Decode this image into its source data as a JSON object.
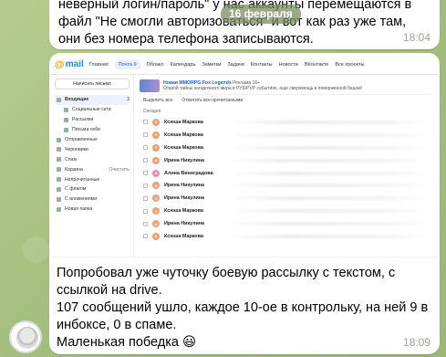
{
  "top_message": {
    "text": "неверный логин/пароль\" у нас аккаунты перемещаются в файл \"Не смогли авторизоваться\" и вот как раз уже там, они без номера телефона записываются.",
    "time": "18:04"
  },
  "date_separator": "16 февраля",
  "screenshot": {
    "logo": "mail",
    "nav": [
      "Главная",
      "Почта 9",
      "Облако",
      "Календарь",
      "Заметки",
      "Задачи",
      "Контакты",
      "Новости",
      "ВКонтакте",
      "Все проекты"
    ],
    "write_button": "Написать письмо",
    "folders": [
      {
        "label": "Входящие",
        "count": "3",
        "selected": true,
        "sub": false
      },
      {
        "label": "Социальные сети",
        "count": "",
        "selected": false,
        "sub": true
      },
      {
        "label": "Рассылки",
        "count": "",
        "selected": false,
        "sub": true
      },
      {
        "label": "Письма себе",
        "count": "",
        "selected": false,
        "sub": true
      },
      {
        "label": "Отправленные",
        "count": "",
        "selected": false,
        "sub": false
      },
      {
        "label": "Черновики",
        "count": "",
        "selected": false,
        "sub": false
      },
      {
        "label": "Спам",
        "count": "",
        "selected": false,
        "sub": false
      },
      {
        "label": "Корзина",
        "count": "Очистить",
        "selected": false,
        "sub": false
      },
      {
        "label": "Непрочитанные",
        "count": "",
        "selected": false,
        "sub": false
      },
      {
        "label": "С флагом",
        "count": "",
        "selected": false,
        "sub": false
      },
      {
        "label": "С вложениями",
        "count": "",
        "selected": false,
        "sub": false
      },
      {
        "label": "Новая папка",
        "count": "",
        "selected": false,
        "sub": false
      }
    ],
    "banner": {
      "title": "Новая MMORPG Fox Legends",
      "tag": "Реклама 16+",
      "subtitle": "Открой тайны загадочного мира в РУБ/РVP событиях, еще сверхмощь в поверженной башне!"
    },
    "toolbar": {
      "select_all": "Выделить все",
      "mark_read": "Отметить все прочитанными"
    },
    "section": "Сегодня",
    "rows": [
      {
        "initial": "К",
        "sender": "Ксюша Маркова",
        "color": "orange"
      },
      {
        "initial": "К",
        "sender": "Ксюша Маркова",
        "color": "orange"
      },
      {
        "initial": "К",
        "sender": "Ксюша Маркова",
        "color": "orange"
      },
      {
        "initial": "И",
        "sender": "Ирина Никулина",
        "color": "orange"
      },
      {
        "initial": "А",
        "sender": "Алина Виноградова",
        "color": "pink"
      },
      {
        "initial": "И",
        "sender": "Ирина Никулина",
        "color": "orange"
      },
      {
        "initial": "И",
        "sender": "Ирина Никулина",
        "color": "orange"
      },
      {
        "initial": "К",
        "sender": "Ксюша Маркова",
        "color": "orange"
      },
      {
        "initial": "И",
        "sender": "Ирина Никулина",
        "color": "orange"
      },
      {
        "initial": "К",
        "sender": "Ксюша Маркова",
        "color": "orange"
      }
    ]
  },
  "main_message": {
    "line1": "Попробовал уже чуточку боевую рассылку с текстом, с ссылкой на drive.",
    "line2": "107 сообщений ушло, каждое 10-ое в контрольку, на ней 9 в инбоксе, 0 в спаме.",
    "line3": "Маленькая победка",
    "emoji": "😃",
    "time": "18:09"
  }
}
